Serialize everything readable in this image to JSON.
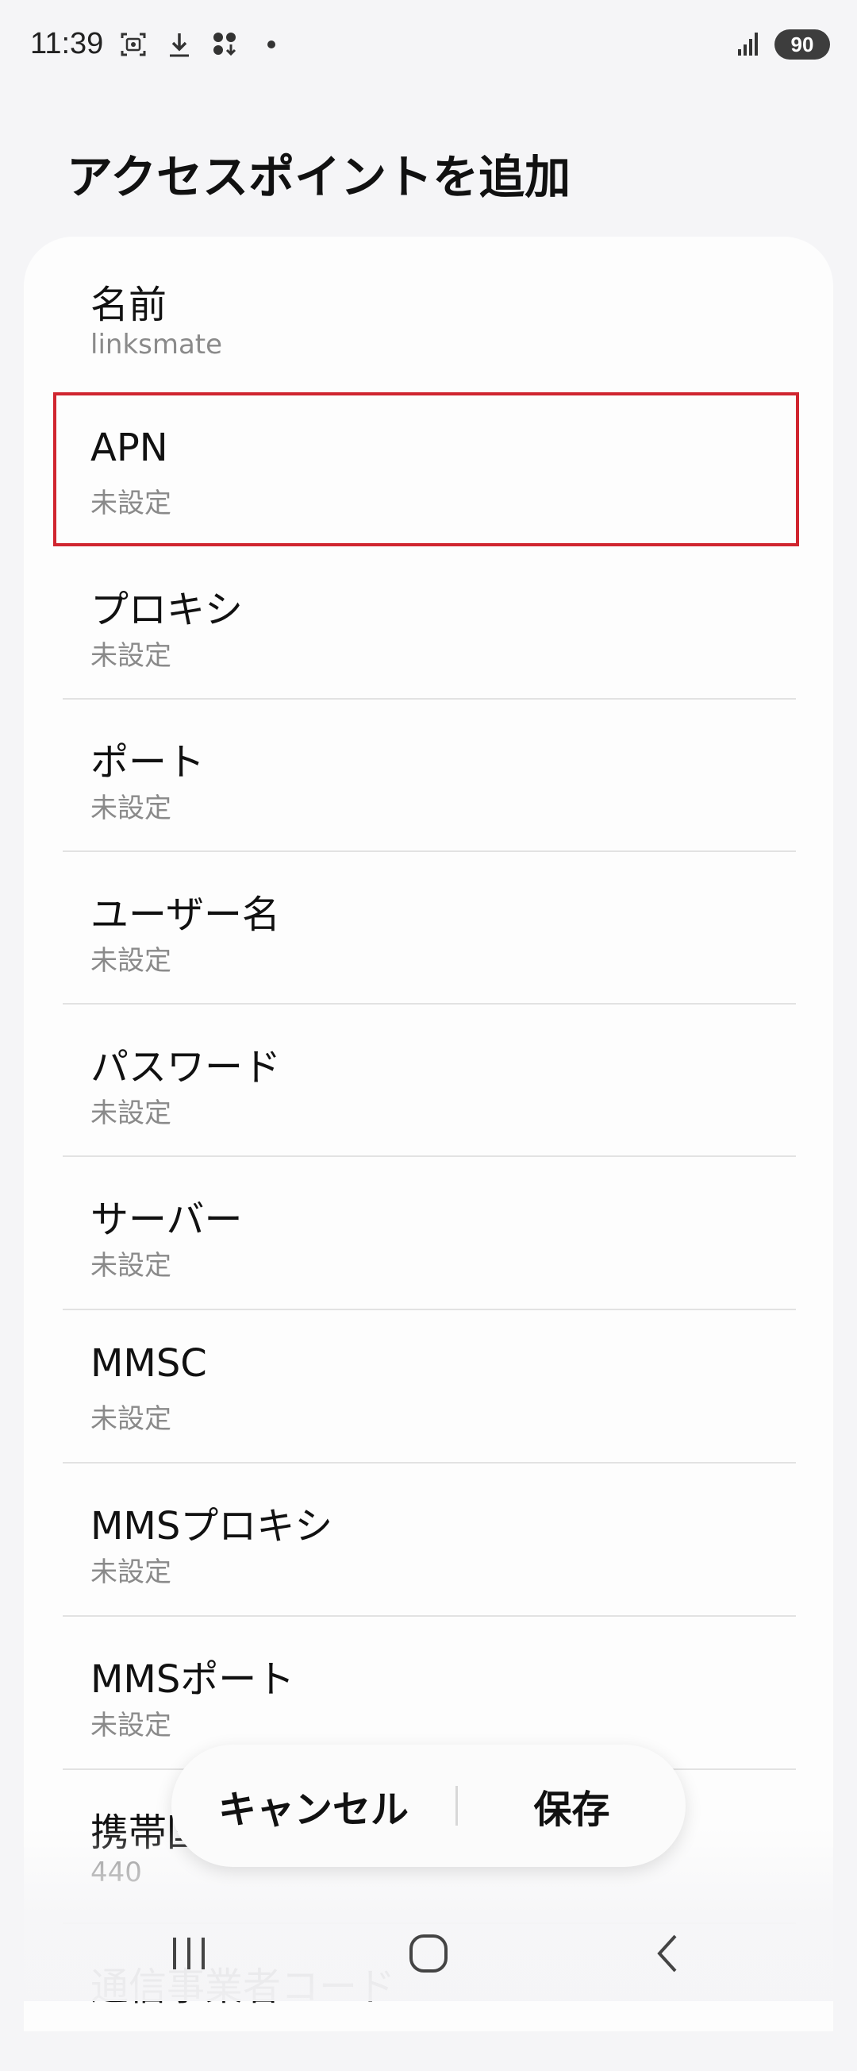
{
  "status_bar": {
    "time": "11:39",
    "battery": "90",
    "icons": [
      "screenshot-icon",
      "download-icon",
      "app-grid-download-icon",
      "dot-icon",
      "signal-icon"
    ]
  },
  "page": {
    "title": "アクセスポイントを追加"
  },
  "fields": [
    {
      "label": "名前",
      "value": "linksmate"
    },
    {
      "label": "APN",
      "value": "未設定"
    },
    {
      "label": "プロキシ",
      "value": "未設定"
    },
    {
      "label": "ポート",
      "value": "未設定"
    },
    {
      "label": "ユーザー名",
      "value": "未設定"
    },
    {
      "label": "パスワード",
      "value": "未設定"
    },
    {
      "label": "サーバー",
      "value": "未設定"
    },
    {
      "label": "MMSC",
      "value": "未設定"
    },
    {
      "label": "MMSプロキシ",
      "value": "未設定"
    },
    {
      "label": "MMSポート",
      "value": "未設定"
    },
    {
      "label": "携帯国番号",
      "value": "440"
    },
    {
      "label": "通信事業者コード",
      "value": ""
    }
  ],
  "actions": {
    "cancel": "キャンセル",
    "save": "保存"
  },
  "nav": {
    "icons": [
      "recent-apps-icon",
      "home-icon",
      "back-icon"
    ]
  },
  "colors": {
    "highlight": "#d0252f",
    "background": "#f5f5f7",
    "card": "#fdfdfd"
  }
}
